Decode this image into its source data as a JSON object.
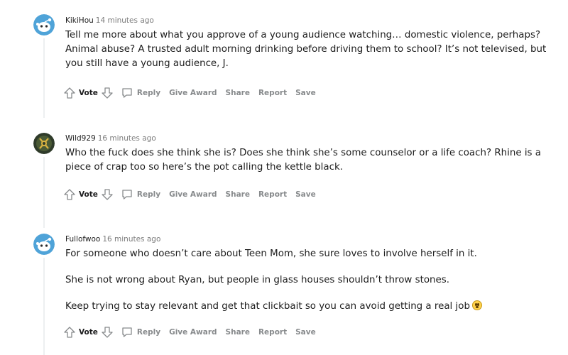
{
  "comments": [
    {
      "username": "KikiHou",
      "time": "14 minutes ago",
      "paragraphs": [
        "Tell me more about what you approve of a young audience watching… domestic violence, perhaps? Animal abuse? A trusted adult morning drinking before driving them to school? It’s not televised, but you still have a young audience, J."
      ],
      "actions": {
        "vote": "Vote",
        "reply": "Reply",
        "award": "Give Award",
        "share": "Share",
        "report": "Report",
        "save": "Save"
      }
    },
    {
      "username": "Wild929",
      "time": "16 minutes ago",
      "paragraphs": [
        "Who the fuck does she think she is? Does she think she’s some counselor or a life coach? Rhine is a piece of crap too so here’s the pot calling the kettle black."
      ],
      "actions": {
        "vote": "Vote",
        "reply": "Reply",
        "award": "Give Award",
        "share": "Share",
        "report": "Report",
        "save": "Save"
      }
    },
    {
      "username": "Fullofwoo",
      "time": "16 minutes ago",
      "paragraphs": [
        "For someone who doesn’t care about Teen Mom, she sure loves to involve herself in it.",
        "She is not wrong about Ryan, but people in glass houses shouldn’t throw stones.",
        "Keep trying to stay relevant and get that clickbait so you can avoid getting a real job"
      ],
      "emoji": "flushed-face-emoji",
      "actions": {
        "vote": "Vote",
        "reply": "Reply",
        "award": "Give Award",
        "share": "Share",
        "report": "Report",
        "save": "Save"
      }
    }
  ],
  "colors": {
    "text": "#1c1c1c",
    "meta": "#7c7c7c",
    "action": "#878a8c",
    "thread_line": "#edeff1",
    "avatar_blue": "#4fa3d8"
  }
}
